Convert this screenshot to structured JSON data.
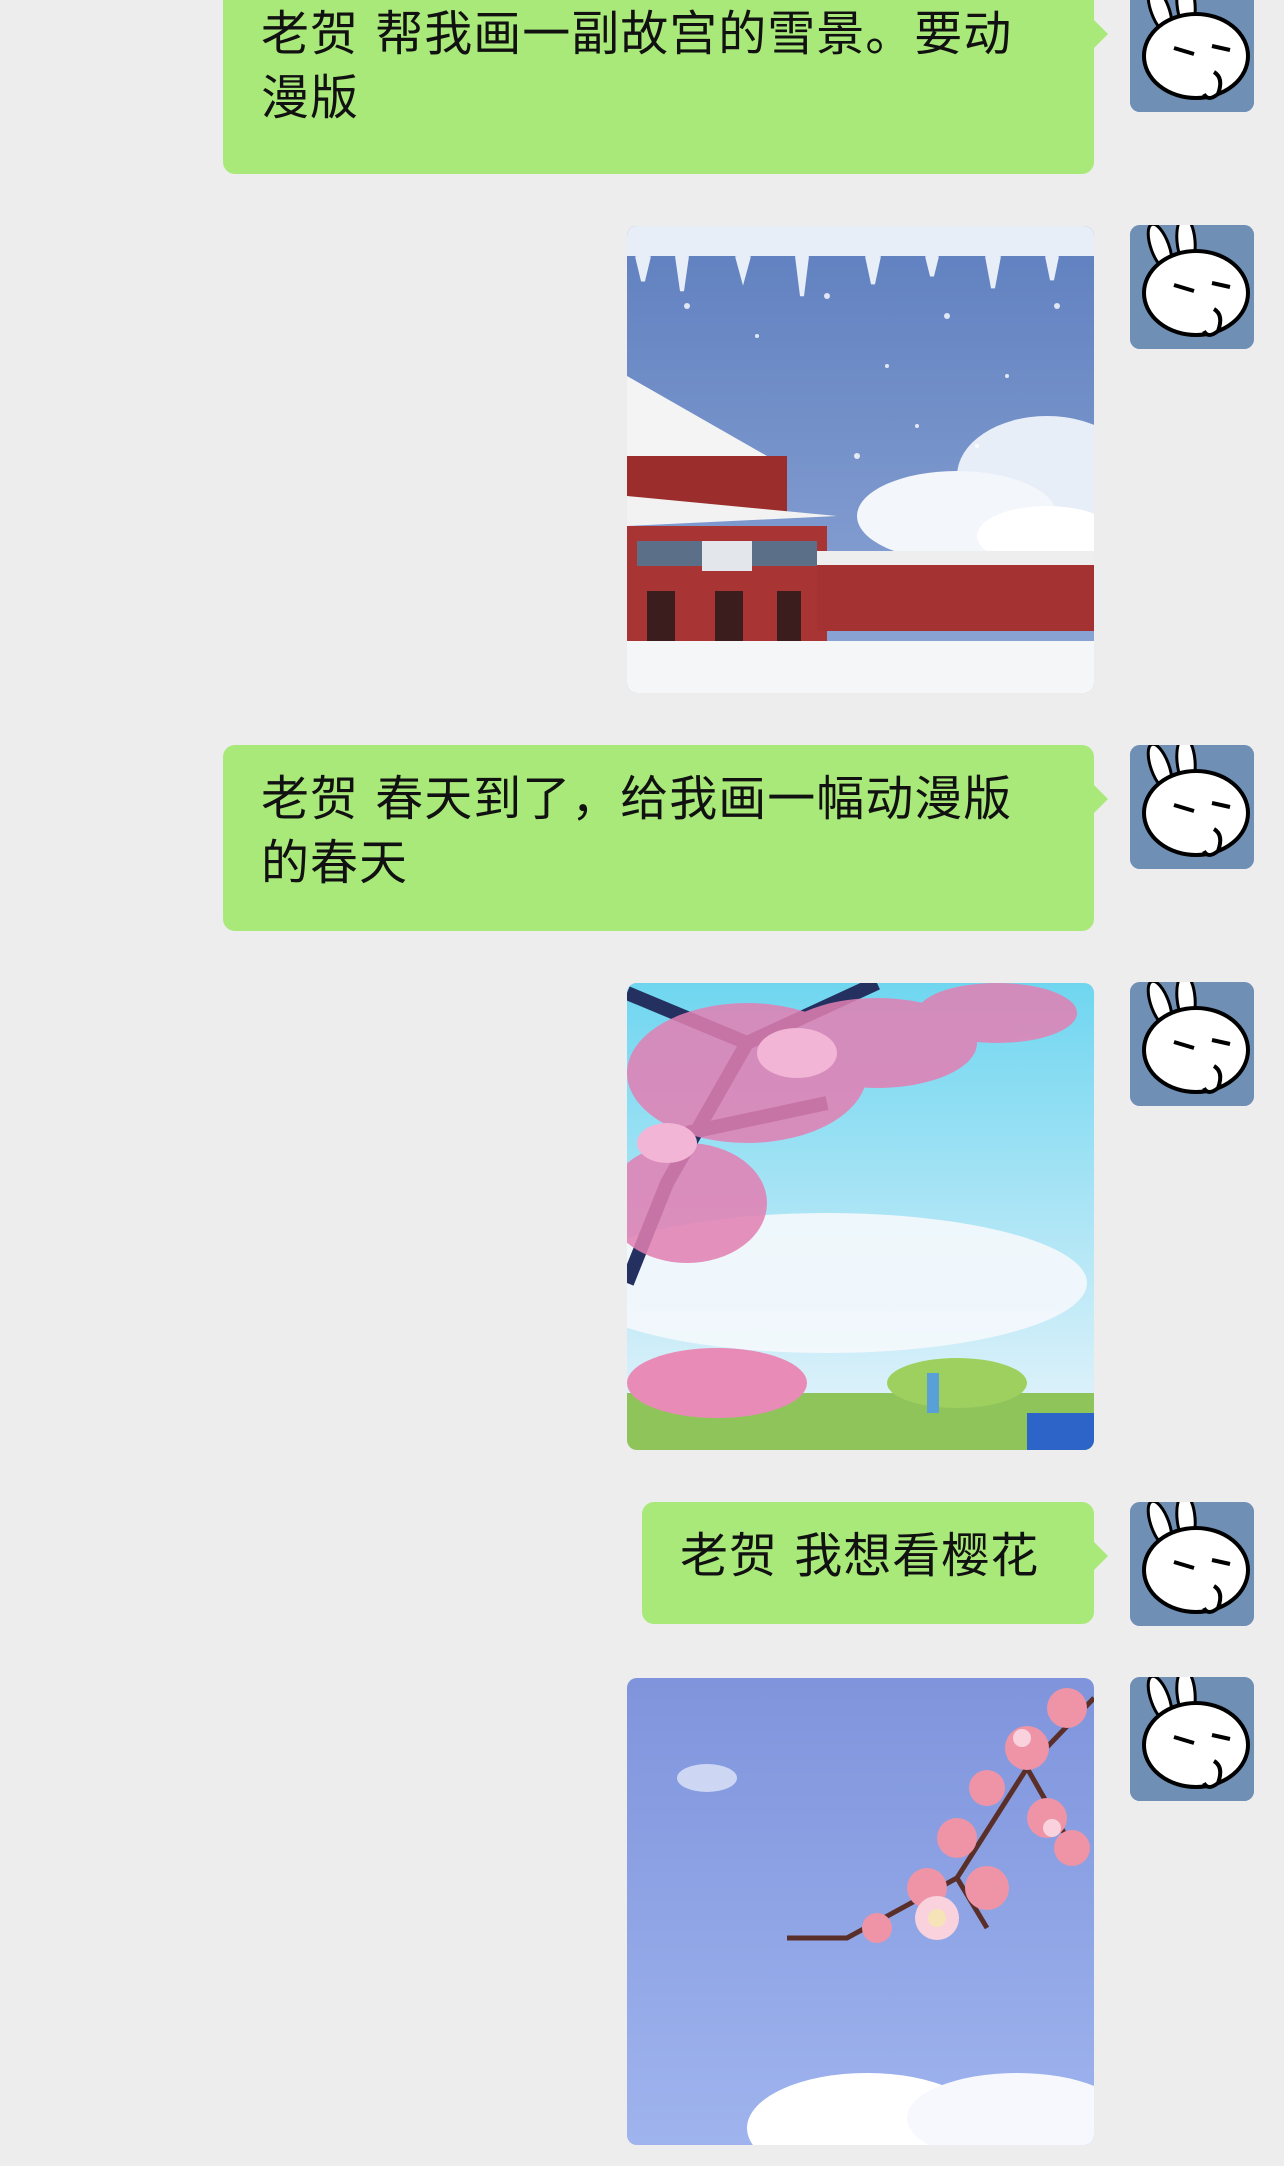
{
  "messages": [
    {
      "type": "text",
      "text": "老贺 帮我画一副故宫的雪景。要动漫版"
    },
    {
      "type": "image",
      "image": "snowy-forbidden-city-anime"
    },
    {
      "type": "text",
      "text": "老贺 春天到了，给我画一幅动漫版的春天"
    },
    {
      "type": "image",
      "image": "spring-cherry-trees-anime"
    },
    {
      "type": "text",
      "text": "老贺 我想看樱花"
    },
    {
      "type": "image",
      "image": "cherry-blossom-branch-sky"
    }
  ],
  "avatar": {
    "icon": "tuzki-rabbit-avatar"
  },
  "colors": {
    "background": "#ededed",
    "bubble": "#a9e97a",
    "text": "#111111"
  }
}
